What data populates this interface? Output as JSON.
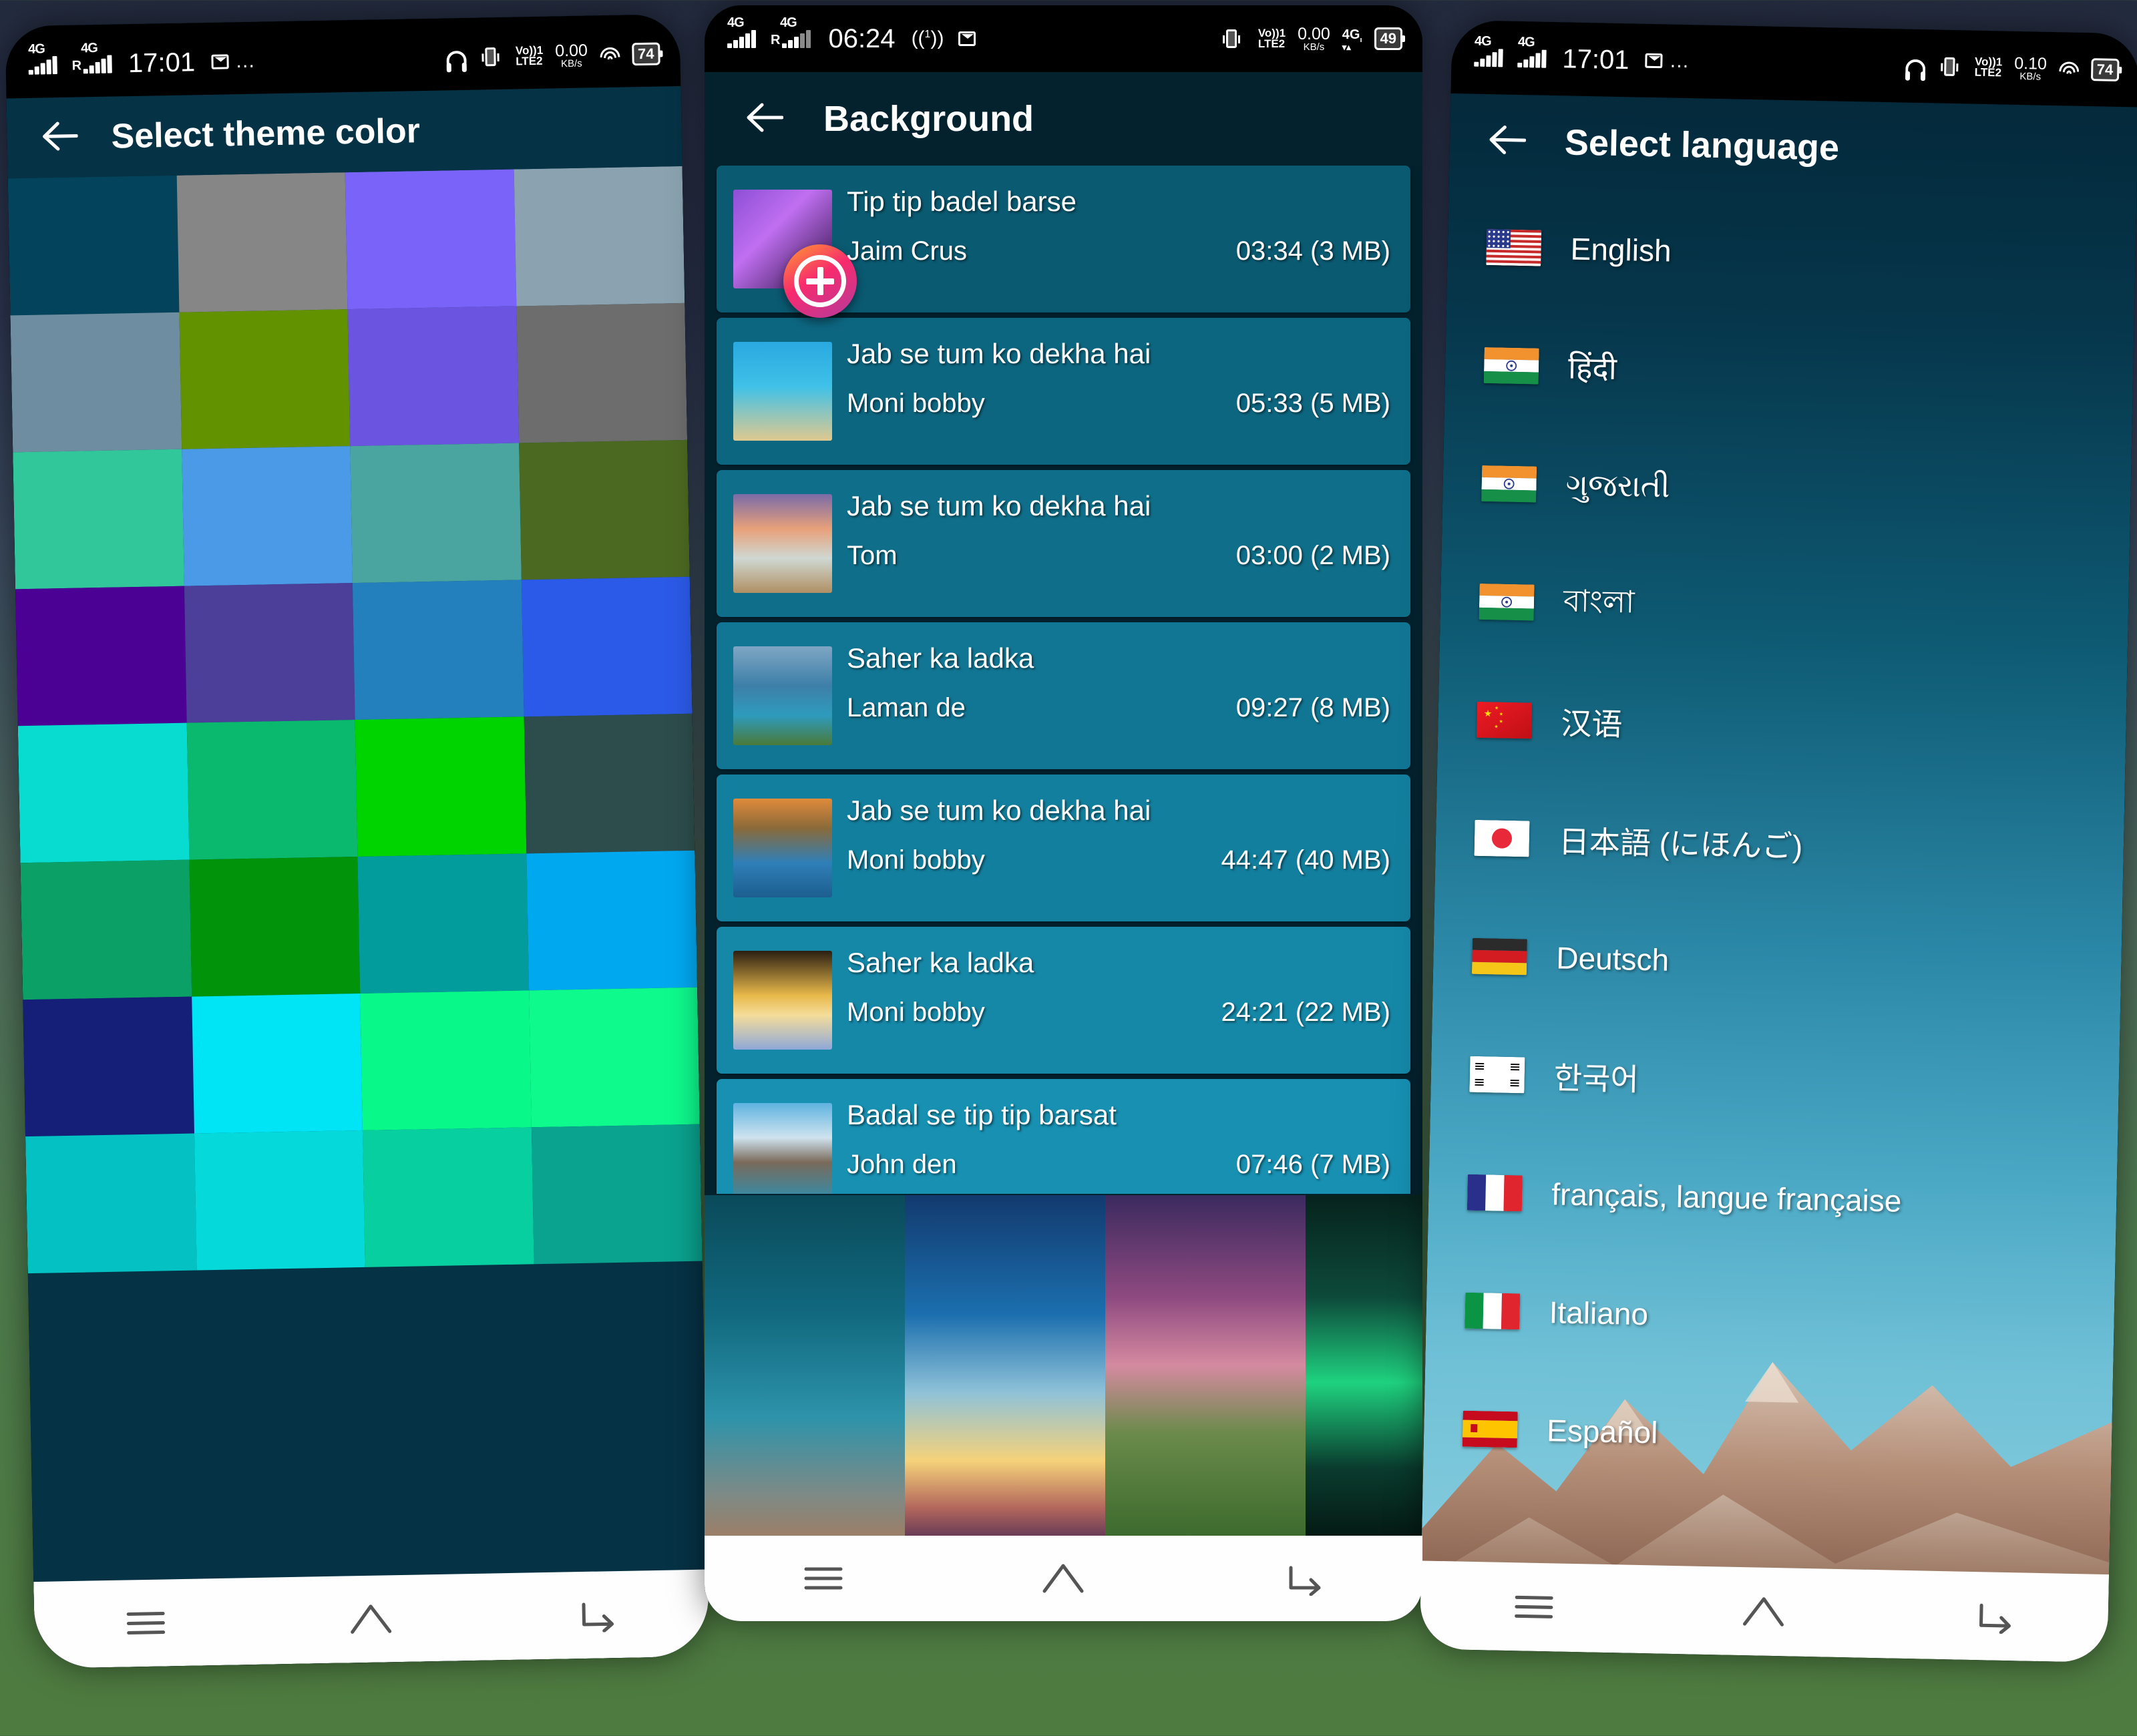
{
  "phone1": {
    "status": {
      "net1": "4G",
      "net2": "4G",
      "roam": "R",
      "time": "17:01",
      "mail": "mail-icon",
      "overflow": "…",
      "headset": "headset-icon",
      "vibrate": "vibrate-icon",
      "volte": "VoLTE",
      "volte_sim": "1",
      "rate": "0.00",
      "rate_unit": "KB/s",
      "wifi": "wifi-icon",
      "battery": "74"
    },
    "appbar": {
      "back": "back-arrow-icon",
      "title": "Select theme color"
    },
    "colors": [
      "#03445c",
      "#868686",
      "#7a63f8",
      "#8ba3b0",
      "#6e8da0",
      "#629200",
      "#6b55e0",
      "#6d6d6d",
      "#31c79b",
      "#4a9ae8",
      "#4aa49f",
      "#4c6921",
      "#4b0194",
      "#4c3f99",
      "#2480bc",
      "#2c5ae8",
      "#08dcd1",
      "#0ab86e",
      "#00d400",
      "#2d4d4c",
      "#0aa066",
      "#01930a",
      "#039c9c",
      "#00a8f0",
      "#151f78",
      "#00e5f5",
      "#08f98a",
      "#0efa8c",
      "#04c2c4",
      "#06d9d9",
      "#08cfa0",
      "#0aa38f"
    ],
    "nav": {
      "recent": "menu-icon",
      "home": "home-icon",
      "back": "back-icon"
    }
  },
  "phone2": {
    "status": {
      "net1": "4G",
      "net2": "4G",
      "roam": "R",
      "time": "06:24",
      "hotspot": "hotspot-icon",
      "mail": "mail-icon",
      "vibrate": "vibrate-icon",
      "volte": "VoLTE",
      "volte_sim": "1",
      "rate": "0.00",
      "rate_unit": "KB/s",
      "data": "4G",
      "battery": "49"
    },
    "appbar": {
      "back": "back-arrow-icon",
      "title": "Background"
    },
    "songs": [
      {
        "name": "Tip tip badel barse",
        "artist": "Jaim Crus",
        "duration": "03:34",
        "size": "(3 MB)",
        "art": "tree-purple"
      },
      {
        "name": "Jab se tum ko dekha hai",
        "artist": "Moni bobby",
        "duration": "05:33",
        "size": "(5 MB)",
        "art": "palm-beach"
      },
      {
        "name": "Jab se tum ko dekha hai",
        "artist": "Tom",
        "duration": "03:00",
        "size": "(2 MB)",
        "art": "sunset-sea"
      },
      {
        "name": "Saher ka ladka",
        "artist": "Laman de",
        "duration": "09:27",
        "size": "(8 MB)",
        "art": "lake-pier"
      },
      {
        "name": "Jab se tum ko dekha hai",
        "artist": "Moni bobby",
        "duration": "44:47",
        "size": "(40 MB)",
        "art": "swans-lake"
      },
      {
        "name": "Saher ka ladka",
        "artist": "Moni bobby",
        "duration": "24:21",
        "size": "(22 MB)",
        "art": "golden-bubble"
      },
      {
        "name": "Badal se tip tip barsat",
        "artist": "John den",
        "duration": "07:46",
        "size": "(7 MB)",
        "art": "snow-mountain"
      }
    ],
    "wallpapers": [
      "teal-mountain",
      "sunset-lake",
      "green-cliff",
      "aurora-falls"
    ],
    "fab": "add-background-button",
    "nav": {
      "recent": "menu-icon",
      "home": "home-icon",
      "back": "back-icon"
    }
  },
  "phone3": {
    "status": {
      "net1": "4G",
      "net2": "4G",
      "time": "17:01",
      "mail": "mail-icon",
      "overflow": "…",
      "headset": "headset-icon",
      "vibrate": "vibrate-icon",
      "volte": "VoLTE",
      "volte_sim": "1",
      "rate": "0.10",
      "rate_unit": "KB/s",
      "wifi": "wifi-icon",
      "battery": "74"
    },
    "appbar": {
      "back": "back-arrow-icon",
      "title": "Select language"
    },
    "languages": [
      {
        "label": "English",
        "flag": "us"
      },
      {
        "label": "हिंदी",
        "flag": "in"
      },
      {
        "label": "ગુજરાતી",
        "flag": "in"
      },
      {
        "label": "বাংলা",
        "flag": "in"
      },
      {
        "label": "汉语",
        "flag": "cn"
      },
      {
        "label": "日本語 (にほんご)",
        "flag": "jp"
      },
      {
        "label": "Deutsch",
        "flag": "de"
      },
      {
        "label": "한국어",
        "flag": "kr"
      },
      {
        "label": "français, langue française",
        "flag": "fr"
      },
      {
        "label": "Italiano",
        "flag": "it"
      },
      {
        "label": "Español",
        "flag": "es"
      }
    ],
    "nav": {
      "recent": "menu-icon",
      "home": "home-icon",
      "back": "back-icon"
    }
  }
}
